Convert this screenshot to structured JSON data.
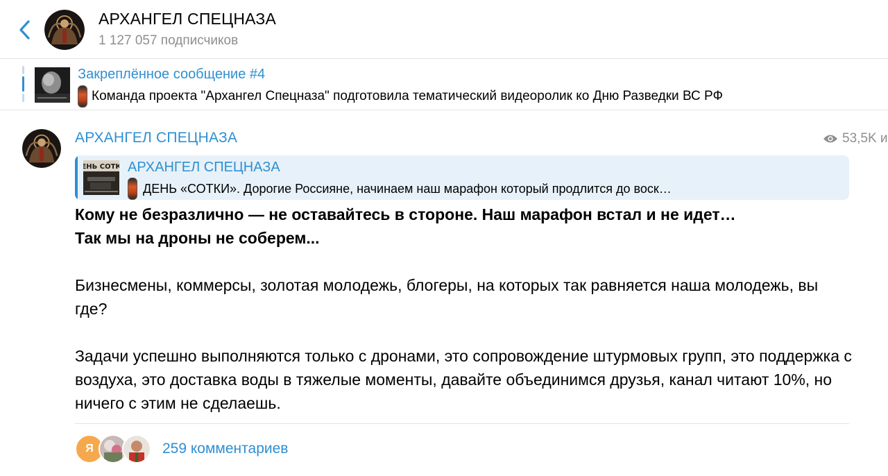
{
  "header": {
    "title": "АРХАНГЕЛ СПЕЦНАЗА",
    "subscribers": "1 127 057 подписчиков"
  },
  "pinned": {
    "title": "Закреплённое сообщение #4",
    "text": "Команда проекта \"Архангел Спецназа\" подготовила тематический видеоролик ко Дню Разведки ВС РФ"
  },
  "post": {
    "author": "АРХАНГЕЛ СПЕЦНАЗА",
    "views": "53,5K и",
    "reply": {
      "author": "АРХАНГЕЛ СПЕЦНАЗА",
      "thumb_label": "ЕНЬ СОТК",
      "text": "ДЕНЬ «СОТКИ».  Дорогие Россияне, начинаем наш марафон который продлится до воск…"
    },
    "paragraphs": {
      "bold_line1": "Кому не безразлично — не оставайтесь в стороне. Наш марафон встал и не идет…",
      "bold_line2": "Так мы на дроны не соберем...",
      "p2": "Бизнесмены, коммерсы, золотая молодежь, блогеры, на которых так равняется наша молодежь, вы где?",
      "p3": "Задачи успешно выполняются только с дронами, это сопровождение штурмовых групп, это поддержка с воздуха, это доставка воды в тяжелые моменты, давайте объединимся друзья, канал читают 10%, но ничего с этим не сделаешь."
    },
    "comments": {
      "avatar_letter": "Я",
      "label": "259 комментариев"
    }
  },
  "colors": {
    "accent": "#2f8fd2",
    "secondary_text": "#8e8e93",
    "reply_bg": "#e7f1f9"
  },
  "icons": [
    "back-chevron-icon",
    "eye-icon",
    "rocket-emoji-icon"
  ]
}
